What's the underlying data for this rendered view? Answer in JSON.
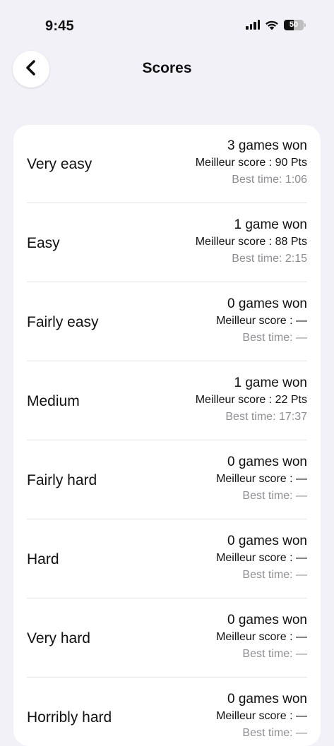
{
  "status_bar": {
    "time": "9:45",
    "battery_level": "50",
    "battery_fraction": 0.5
  },
  "header": {
    "title": "Scores",
    "back_icon": "chevron-left-icon"
  },
  "levels": [
    {
      "name": "Very easy",
      "games_won": "3 games won",
      "best_score": "Meilleur score : 90 Pts",
      "best_time": "Best time: 1:06"
    },
    {
      "name": "Easy",
      "games_won": "1 game won",
      "best_score": "Meilleur score : 88 Pts",
      "best_time": "Best time: 2:15"
    },
    {
      "name": "Fairly easy",
      "games_won": "0 games won",
      "best_score": "Meilleur score : —",
      "best_time": "Best time: —"
    },
    {
      "name": "Medium",
      "games_won": "1 game won",
      "best_score": "Meilleur score : 22 Pts",
      "best_time": "Best time: 17:37"
    },
    {
      "name": "Fairly hard",
      "games_won": "0 games won",
      "best_score": "Meilleur score : —",
      "best_time": "Best time: —"
    },
    {
      "name": "Hard",
      "games_won": "0 games won",
      "best_score": "Meilleur score : —",
      "best_time": "Best time: —"
    },
    {
      "name": "Very hard",
      "games_won": "0 games won",
      "best_score": "Meilleur score : —",
      "best_time": "Best time: —"
    },
    {
      "name": "Horribly hard",
      "games_won": "0 games won",
      "best_score": "Meilleur score : —",
      "best_time": "Best time: —"
    }
  ],
  "colors": {
    "background": "#f2f1f7",
    "card": "#ffffff",
    "primary_text": "#111111",
    "secondary_text": "#8e8e93",
    "divider": "#e3e3e6"
  }
}
